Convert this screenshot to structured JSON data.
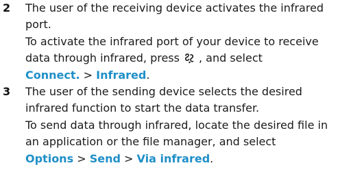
{
  "steps": [
    {
      "number": "2",
      "intro_lines": [
        "The user of the receiving device activates the infrared",
        "port."
      ],
      "detail_lines": [
        "To activate the infrared port of your device to receive"
      ],
      "detail_line2_before_icon": "data through infrared, press",
      "detail_line2_after_icon": ", and select",
      "icon": "menu-key-icon",
      "path": [
        "Connect.",
        "Infrared"
      ],
      "path_separator": ">",
      "path_end": "."
    },
    {
      "number": "3",
      "intro_lines": [
        "The user of the sending device selects the desired",
        "infrared function to start the data transfer."
      ],
      "detail_lines": [
        "To send data through infrared, locate the desired file in",
        "an application or the file manager, and select"
      ],
      "path": [
        "Options",
        "Send",
        "Via infrared"
      ],
      "path_separator": ">",
      "path_end": "."
    }
  ],
  "colors": {
    "text": "#1a1a1a",
    "link": "#1f8fc8"
  }
}
